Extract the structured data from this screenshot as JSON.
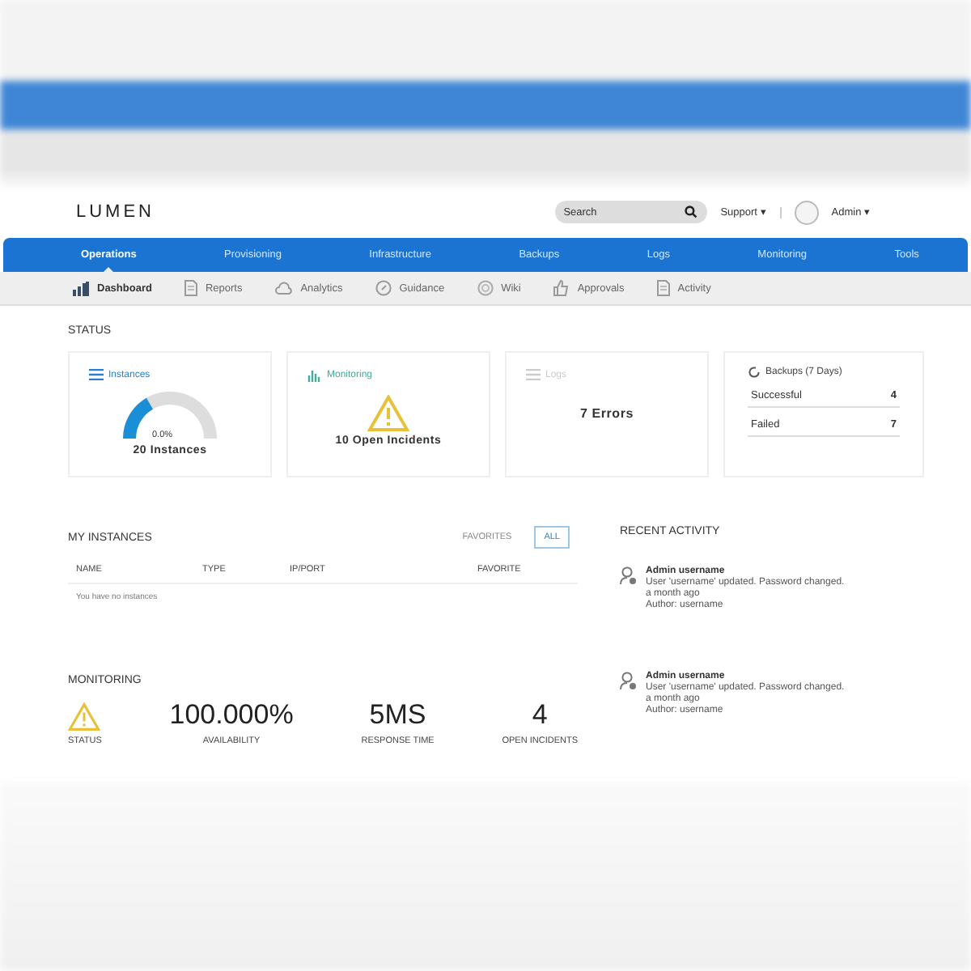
{
  "header": {
    "logo": "LUMEN",
    "search": {
      "placeholder": "Search"
    },
    "support": "Support ▾",
    "admin": "Admin ▾"
  },
  "nav": [
    {
      "label": "Operations",
      "selected": true
    },
    {
      "label": "Provisioning",
      "selected": false
    },
    {
      "label": "Infrastructure",
      "selected": false
    },
    {
      "label": "Backups",
      "selected": false
    },
    {
      "label": "Logs",
      "selected": false
    },
    {
      "label": "Monitoring",
      "selected": false
    },
    {
      "label": "Tools",
      "selected": false
    }
  ],
  "subnav": [
    {
      "label": "Dashboard",
      "selected": true
    },
    {
      "label": "Reports",
      "selected": false
    },
    {
      "label": "Analytics",
      "selected": false
    },
    {
      "label": "Guidance",
      "selected": false
    },
    {
      "label": "Wiki",
      "selected": false
    },
    {
      "label": "Approvals",
      "selected": false
    },
    {
      "label": "Activity",
      "selected": false
    }
  ],
  "status": {
    "title": "STATUS",
    "cards": [
      {
        "kind": "gauge",
        "title": "Instances",
        "level": 0.25,
        "reading": "0.0%",
        "caption": "20 Instances"
      },
      {
        "kind": "warning",
        "title": "Monitoring",
        "caption": "10 Open Incidents"
      },
      {
        "kind": "text",
        "title": "Logs",
        "caption": "7 Errors"
      },
      {
        "kind": "table",
        "title": "Backups (7 Days)",
        "rows": [
          {
            "label": "Successful",
            "value": "4"
          },
          {
            "label": "Failed",
            "value": "7"
          }
        ]
      }
    ]
  },
  "instances": {
    "title": "MY INSTANCES",
    "filters": [
      {
        "label": "FAVORITES",
        "selected": false
      },
      {
        "label": "ALL",
        "selected": true
      }
    ],
    "columns": [
      "NAME",
      "TYPE",
      "IP/PORT",
      "FAVORITE"
    ],
    "empty": "You have no instances"
  },
  "monitoring": {
    "title": "MONITORING",
    "metrics": [
      {
        "kind": "icon",
        "label": "STATUS"
      },
      {
        "kind": "value",
        "value": "100.000%",
        "label": "AVAILABILITY"
      },
      {
        "kind": "value",
        "value": "5MS",
        "label": "RESPONSE TIME"
      },
      {
        "kind": "value",
        "value": "4",
        "label": "OPEN INCIDENTS"
      }
    ]
  },
  "activity": {
    "title": "RECENT ACTIVITY",
    "items": [
      {
        "name": "Admin username",
        "text": "User 'username' updated. Password changed.",
        "time": "a month ago",
        "author": "Author: username"
      },
      {
        "name": "Admin username",
        "text": "User 'username' updated. Password changed.",
        "time": "a month ago",
        "author": "Author: username"
      }
    ]
  }
}
